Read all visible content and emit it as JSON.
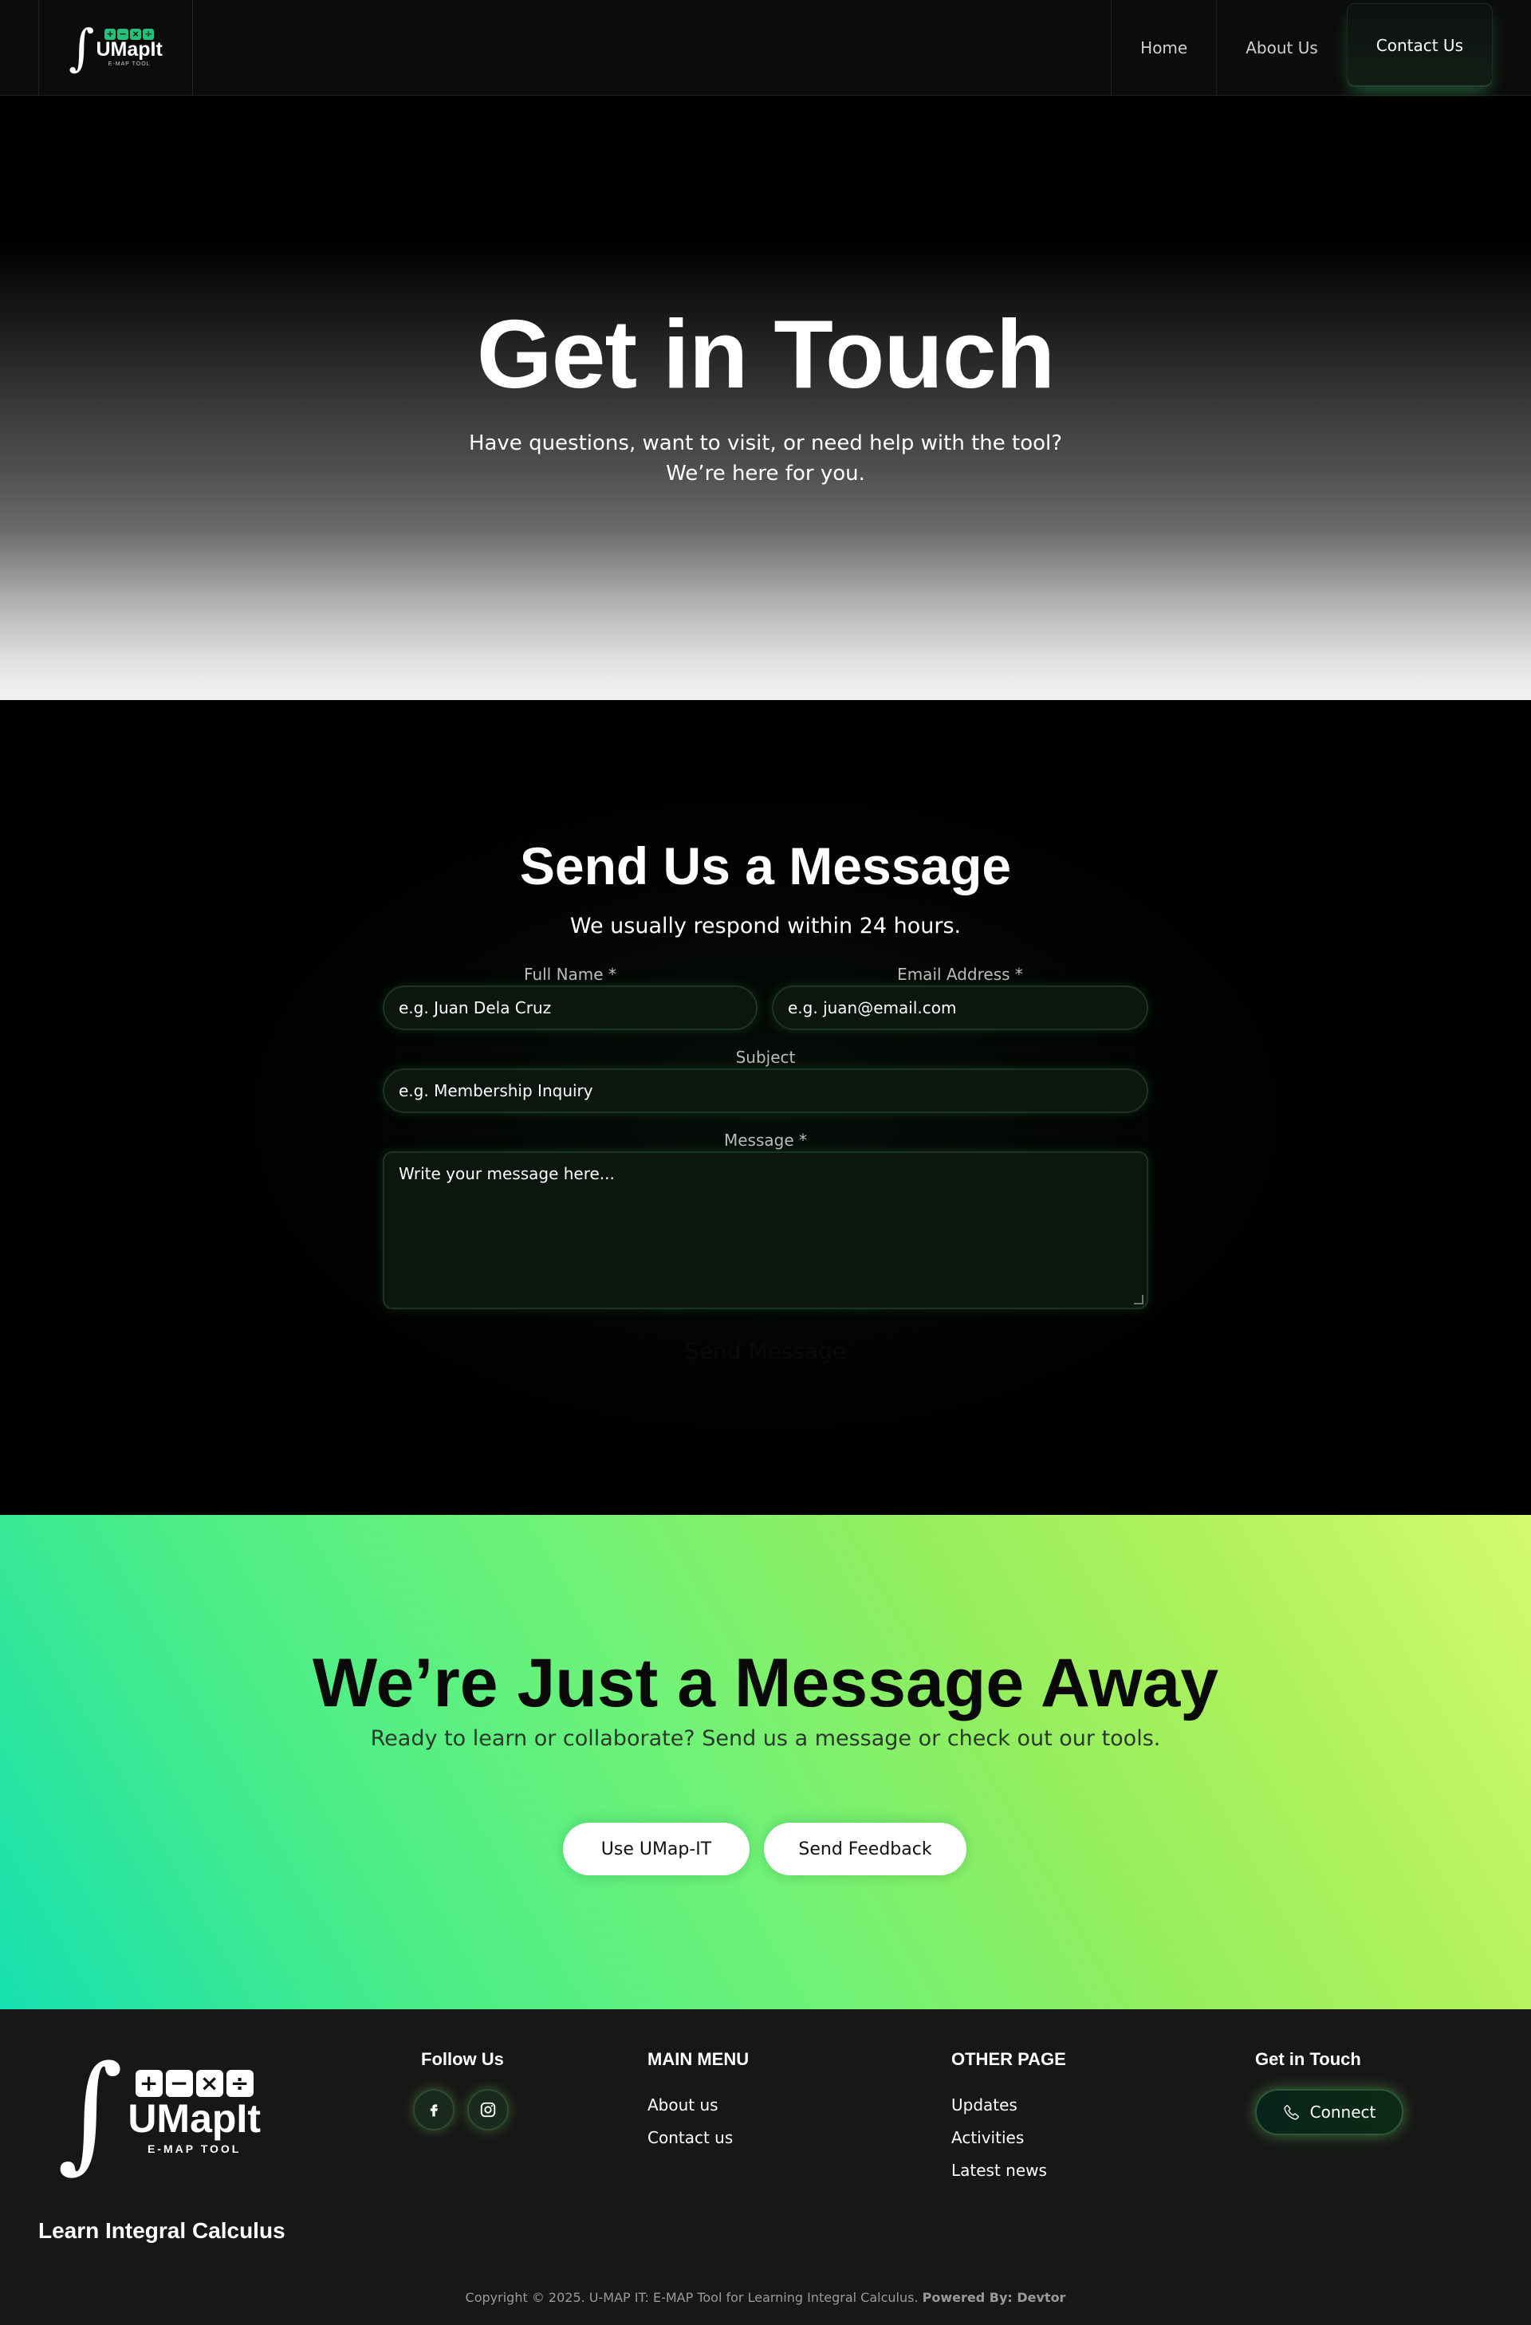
{
  "nav": {
    "logo": {
      "ops": [
        "+",
        "−",
        "×",
        "÷"
      ],
      "word": "UMapIt",
      "sub": "E-MAP TOOL"
    },
    "links": [
      "Home",
      "About Us",
      "Contact Us"
    ],
    "active": "Contact Us"
  },
  "hero": {
    "title": "Get in Touch",
    "subtitle_line1": "Have questions, want to visit, or need help with the tool?",
    "subtitle_line2": "We’re here for you."
  },
  "form": {
    "title": "Send Us a Message",
    "subtitle": "We usually respond within 24 hours.",
    "full_name_label": "Full Name *",
    "full_name_placeholder": "e.g. Juan Dela Cruz",
    "email_label": "Email Address *",
    "email_placeholder": "e.g. juan@email.com",
    "subject_label": "Subject",
    "subject_placeholder": "e.g. Membership Inquiry",
    "message_label": "Message *",
    "message_placeholder": "Write your message here...",
    "submit_label": "Send Message"
  },
  "cta": {
    "title": "We’re Just a Message Away",
    "subtitle": "Ready to learn or collaborate? Send us a message or check out our tools.",
    "btn_primary": "Use UMap-IT",
    "btn_secondary": "Send Feedback"
  },
  "footer": {
    "logo": {
      "ops": [
        "+",
        "−",
        "×",
        "÷"
      ],
      "word": "UMapIt",
      "sub": "E-MAP TOOL"
    },
    "follow_title": "Follow Us",
    "social_icons": [
      "facebook-icon",
      "instagram-icon"
    ],
    "main_menu_title": "MAIN MENU",
    "main_menu": [
      "About us",
      "Contact us"
    ],
    "other_title": "OTHER PAGE",
    "other_pages": [
      "Updates",
      "Activities",
      "Latest news"
    ],
    "contact_title": "Get in Touch",
    "connect_label": "Connect",
    "tagline": "Learn Integral Calculus",
    "copyright": "Copyright © 2025. U-MAP IT: E-MAP Tool for Learning Integral Calculus.",
    "powered": "Powered By: Devtor"
  },
  "colors": {
    "accent_green": "#23c27a",
    "footer_bg": "#171717",
    "cta_gradient_start": "#16e0b0",
    "cta_gradient_end": "#d3fb6e"
  }
}
